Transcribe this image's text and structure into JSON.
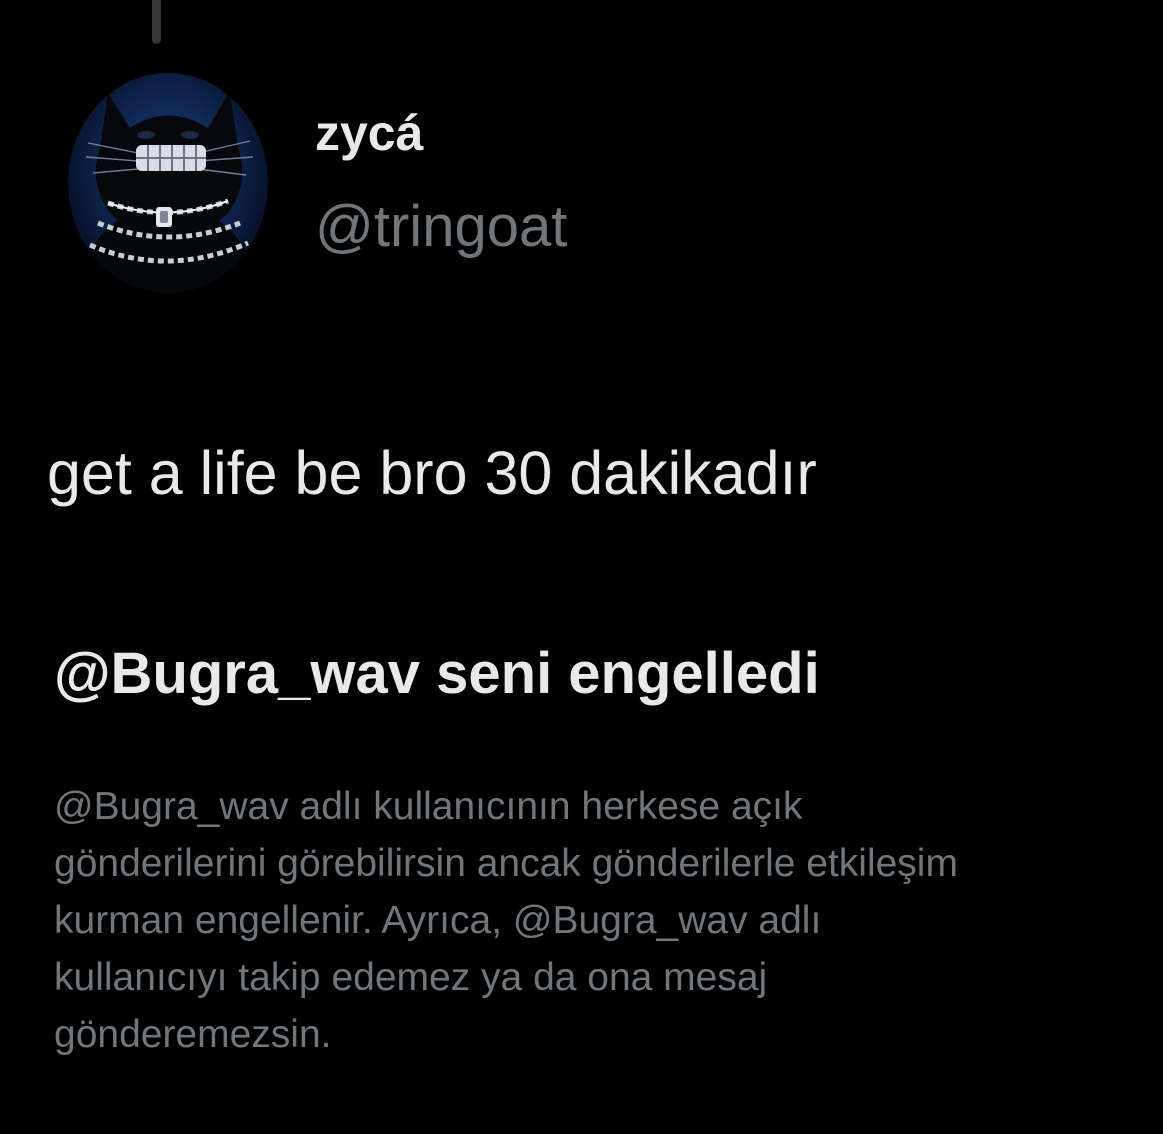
{
  "colors": {
    "background": "#000000",
    "primary_text": "#e7e9ea",
    "secondary_text": "#71767b",
    "thread_line": "#333639"
  },
  "tweet": {
    "author": {
      "display_name": "zycá",
      "handle": "@tringoat",
      "avatar_icon": "black-cat-avatar"
    },
    "text": "get a life be bro 30 dakikadır"
  },
  "block_notice": {
    "title": "@Bugra_wav seni engelledi",
    "body_lines": [
      "@Bugra_wav adlı kullanıcının herkese açık",
      "gönderilerini görebilirsin ancak gönderilerle etkileşim",
      "kurman engellenir. Ayrıca, @Bugra_wav adlı",
      "kullanıcıyı takip edemez ya da ona mesaj",
      "gönderemezsin."
    ]
  }
}
